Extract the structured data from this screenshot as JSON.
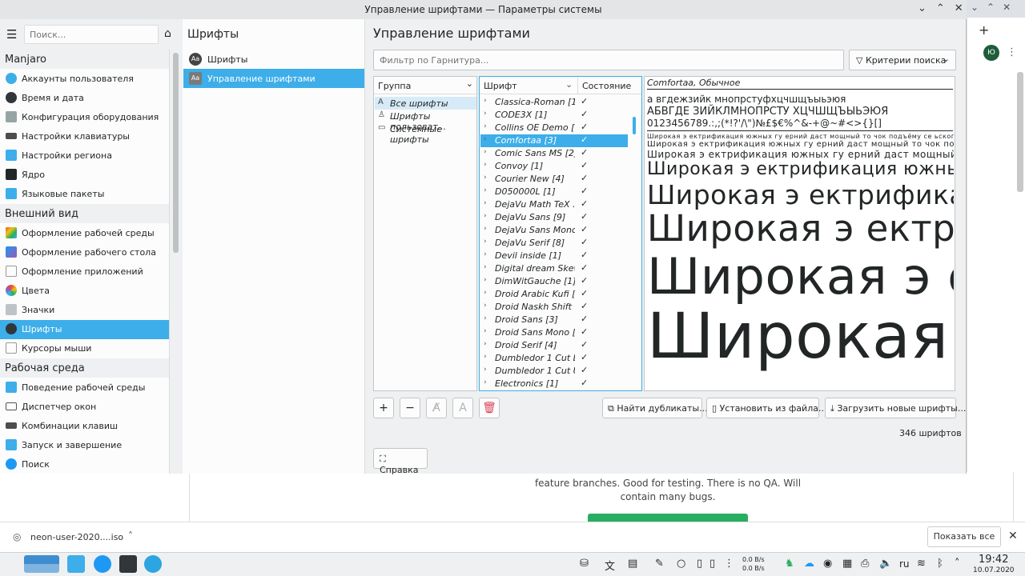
{
  "browser": {
    "body_text": "feature branches. Good for testing. There is no QA. Will contain many bugs.",
    "avatar_letter": "Ю",
    "download_name": "neon-user-2020....iso",
    "show_all_label": "Показать все"
  },
  "window": {
    "title": "Управление шрифтами — Параметры системы"
  },
  "sidebar": {
    "search_placeholder": "Поиск...",
    "categories": [
      "Manjaro",
      "Внешний вид",
      "Рабочая среда"
    ],
    "items": [
      {
        "label": "Аккаунты пользователя"
      },
      {
        "label": "Время и дата"
      },
      {
        "label": "Конфигурация оборудования"
      },
      {
        "label": "Настройки клавиатуры"
      },
      {
        "label": "Настройки региона"
      },
      {
        "label": "Ядро"
      },
      {
        "label": "Языковые пакеты"
      },
      {
        "label": "Оформление рабочей среды"
      },
      {
        "label": "Оформление рабочего стола"
      },
      {
        "label": "Оформление приложений"
      },
      {
        "label": "Цвета"
      },
      {
        "label": "Значки"
      },
      {
        "label": "Шрифты"
      },
      {
        "label": "Курсоры мыши"
      },
      {
        "label": "Поведение рабочей среды"
      },
      {
        "label": "Диспетчер окон"
      },
      {
        "label": "Комбинации клавиш"
      },
      {
        "label": "Запуск и завершение"
      },
      {
        "label": "Поиск"
      }
    ]
  },
  "middle": {
    "title": "Шрифты",
    "items": [
      {
        "label": "Шрифты"
      },
      {
        "label": "Управление шрифтами"
      }
    ]
  },
  "main": {
    "title": "Управление шрифтами",
    "filter_placeholder": "Фильтр по Гарнитура...",
    "criteria_label": "Критерии поиска",
    "group_header": "Группа",
    "groups": [
      {
        "label": "Все шрифты"
      },
      {
        "label": "Шрифты пользоват..."
      },
      {
        "label": "Системные шрифты"
      }
    ],
    "font_header": "Шрифт",
    "state_header": "Состояние",
    "fonts": [
      "Classica-Roman [1]",
      "CODE3X [1]",
      "Collins OE Demo [1]",
      "Comfortaa [3]",
      "Comic Sans MS [2]",
      "Convoy [1]",
      "Courier New [4]",
      "D050000L [1]",
      "DejaVu Math TeX ...",
      "DejaVu Sans [9]",
      "DejaVu Sans Mono ...",
      "DejaVu Serif [8]",
      "Devil inside [1]",
      "Digital dream Skew...",
      "DimWitGauche [1]",
      "Droid Arabic Kufi [...",
      "Droid Naskh Shift ...",
      "Droid Sans [3]",
      "Droid Sans Mono [1]",
      "Droid Serif [4]",
      "Dumbledor 1 Cut D...",
      "Dumbledor 1 Cut U...",
      "Electronics [1]"
    ],
    "check_mark": "✓",
    "preview": {
      "title": "Comfortaa, Обычное",
      "lowercase": "а  вгдежзийк  мнопрстуфхцчшщъыьэюя",
      "uppercase": "АБВГДЕ   ЗИЙКЛМНОПРСТУ   ХЦЧШЩЪЫЬЭЮЯ",
      "numbers": "0123456789.:,;(*!?'/\\\")№£$€%^&-+@~#<>{}[]",
      "sample": "Широкая  э  ектрификация южных гу  ерний даст мощный то  чок подъёму се  ьского хозяйства"
    },
    "find_dup_label": "Найти дубликаты...",
    "install_label": "Установить из файла...",
    "download_label": "Загрузить новые шрифты...",
    "count_label": "346 шрифтов",
    "help_label": "Справка"
  },
  "taskbar": {
    "net_up": "0.0 B/s",
    "net_down": "0.0 B/s",
    "lang": "ru",
    "time": "19:42",
    "date": "10.07.2020"
  }
}
